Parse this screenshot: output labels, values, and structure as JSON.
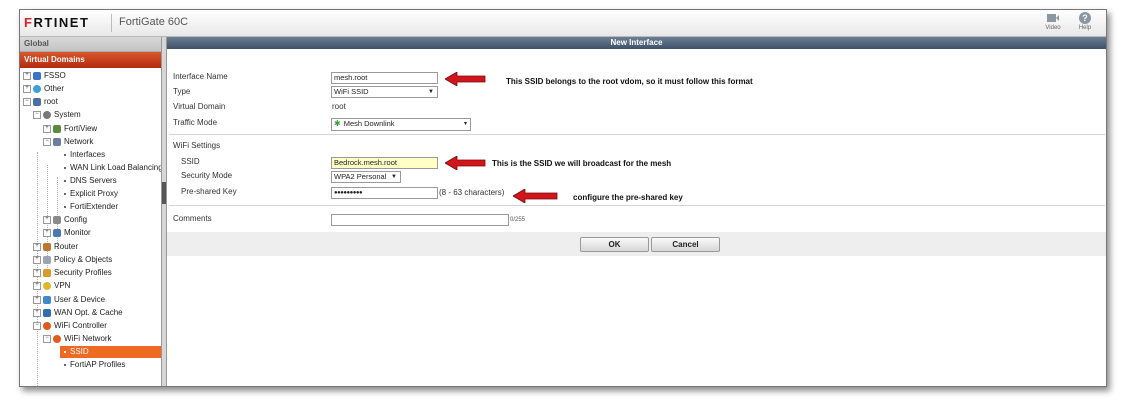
{
  "header": {
    "logo_prefix": "F",
    "logo_rest": "RTINET",
    "device_name": "FortiGate 60C",
    "video_label": "Video",
    "help_label": "Help",
    "help_glyph": "?"
  },
  "sidebar": {
    "global_label": "Global",
    "vdom_label": "Virtual Domains",
    "items": [
      {
        "label": "FSSO",
        "icon": "fsso-icon"
      },
      {
        "label": "Other",
        "icon": "other-icon"
      },
      {
        "label": "root",
        "icon": "vdom-icon"
      },
      {
        "label": "System",
        "icon": "system-icon"
      },
      {
        "label": "FortiView",
        "icon": "fortiview-icon"
      },
      {
        "label": "Network",
        "icon": "network-icon"
      },
      {
        "label": "Interfaces"
      },
      {
        "label": "WAN Link Load Balancing"
      },
      {
        "label": "DNS Servers"
      },
      {
        "label": "Explicit Proxy"
      },
      {
        "label": "FortiExtender"
      },
      {
        "label": "Config",
        "icon": "config-icon"
      },
      {
        "label": "Monitor",
        "icon": "monitor-icon"
      },
      {
        "label": "Router",
        "icon": "router-icon"
      },
      {
        "label": "Policy & Objects",
        "icon": "policy-icon"
      },
      {
        "label": "Security Profiles",
        "icon": "security-icon"
      },
      {
        "label": "VPN",
        "icon": "vpn-icon"
      },
      {
        "label": "User & Device",
        "icon": "user-icon"
      },
      {
        "label": "WAN Opt. & Cache",
        "icon": "wanopt-icon"
      },
      {
        "label": "WiFi Controller",
        "icon": "wifi-icon"
      },
      {
        "label": "WiFi Network",
        "icon": "wifi-icon"
      },
      {
        "label": "SSID"
      },
      {
        "label": "FortiAP Profiles"
      }
    ],
    "expander_plus": "+",
    "expander_minus": "−"
  },
  "form": {
    "title": "New Interface",
    "interface_name_label": "Interface Name",
    "interface_name_value": "mesh.root",
    "type_label": "Type",
    "type_value": "WiFi SSID",
    "virtual_domain_label": "Virtual Domain",
    "virtual_domain_value": "root",
    "traffic_mode_label": "Traffic Mode",
    "traffic_mode_value": "Mesh Downlink",
    "wifi_settings_label": "WiFi Settings",
    "ssid_label": "SSID",
    "ssid_value": "Bedrock.mesh.root",
    "security_mode_label": "Security Mode",
    "security_mode_value": "WPA2 Personal",
    "psk_label": "Pre-shared Key",
    "psk_value": "●●●●●●●●●",
    "psk_hint": "(8 - 63 characters)",
    "comments_label": "Comments",
    "comments_value": "",
    "comments_counter": "0/255",
    "ok_label": "OK",
    "cancel_label": "Cancel"
  },
  "annotations": {
    "interface_note": "This SSID belongs to the root vdom, so it must follow this format",
    "ssid_note": "This is the SSID we will broadcast for the mesh",
    "psk_note": "configure the pre-shared key"
  },
  "colors": {
    "brand_red": "#d2232a",
    "vdom_header": "#c53a18",
    "active_item": "#ee6a22",
    "title_bar": "#4e6079",
    "annotation_arrow": "#d0161b"
  }
}
